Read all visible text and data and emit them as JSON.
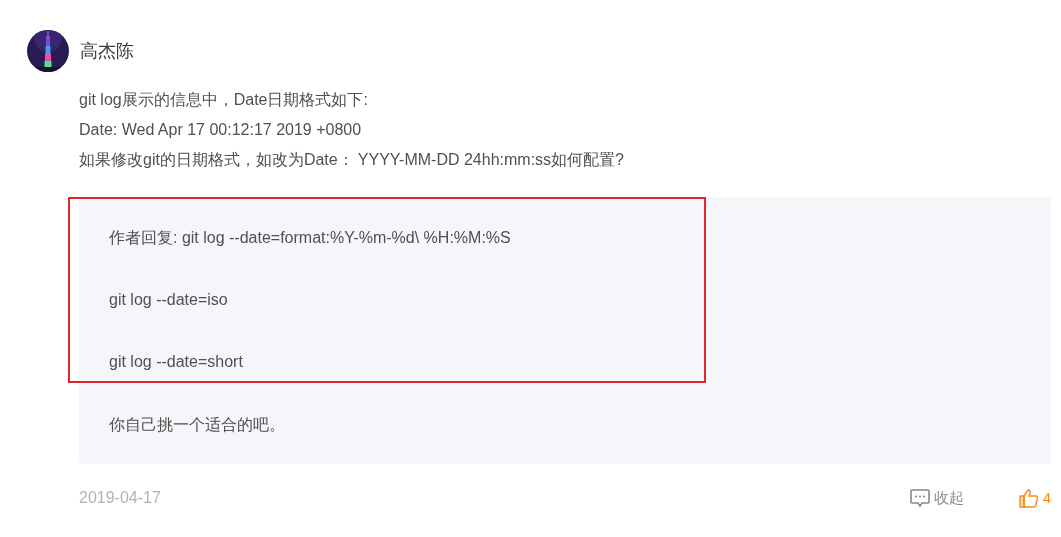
{
  "author": {
    "name": "高杰陈"
  },
  "body": [
    "git log展示的信息中，Date日期格式如下:",
    "Date: Wed Apr 17 00:12:17 2019 +0800",
    "如果修改git的日期格式，如改为Date： YYYY-MM-DD 24hh:mm:ss如何配置?"
  ],
  "reply": [
    {
      "text": "作者回复: git log --date=format:%Y-%m-%d\\ %H:%M:%S",
      "highlighted": true
    },
    {
      "text": "git log --date=iso",
      "highlighted": true
    },
    {
      "text": "git log --date=short",
      "highlighted": true
    },
    {
      "text": "你自己挑一个适合的吧。",
      "highlighted": false
    }
  ],
  "footer": {
    "date": "2019-04-17",
    "collapse": "收起",
    "likes": "4"
  }
}
